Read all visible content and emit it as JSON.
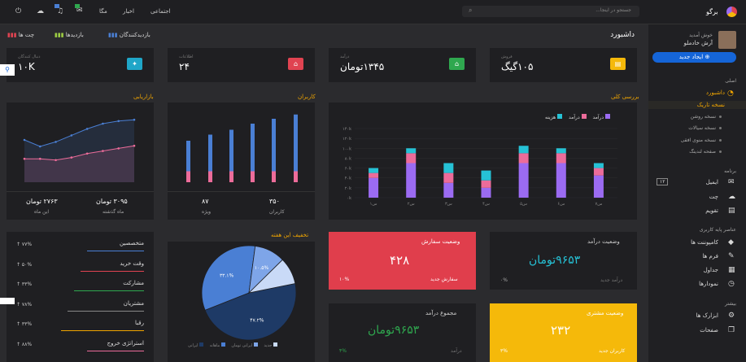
{
  "topbar": {
    "brand": "برگو",
    "search_placeholder": "جستجو در اینجا...",
    "links": [
      "اجتماعی",
      "اخبار",
      "مگا"
    ]
  },
  "sidebar": {
    "greeting": "خوش آمدید",
    "user": "آرش خادملو",
    "create_button": "ایجاد جدید",
    "sections": {
      "main": "اصلی",
      "apps": "برنامه",
      "base": "عناصر پایه کاربری",
      "more": "بیشتر"
    },
    "dashboard": "داشبورد",
    "dark_version": "نسخه تاریک",
    "subs": [
      "نسخه روشن",
      "نسخه سیالات",
      "نسخه منوی افقی",
      "صفحه لندینگ"
    ],
    "email": "ایمیل",
    "email_badge": "۱۲",
    "chat": "چت",
    "calendar": "تقویم",
    "components": "کامپوننت ها",
    "forms": "فرم ها",
    "tables": "جداول",
    "charts": "نمودارها",
    "tools": "ابزارک ها",
    "pages": "صفحات"
  },
  "header": {
    "title": "داشبورد",
    "tab_chat": "چت ها",
    "tab_visits": "بازدیدها",
    "tab_visitors": "بازدیدکنندگان"
  },
  "stats": [
    {
      "label": "فروش",
      "value": "۱۰۵گیگ",
      "color": "#f5b90a",
      "icon": "calendar-icon"
    },
    {
      "label": "درآمد",
      "value": "۱۳۴۵تومان",
      "color": "#2fa84f",
      "icon": "bank-icon"
    },
    {
      "label": "اطلاعات",
      "value": "۲۴",
      "color": "#e04351",
      "icon": "home-icon"
    },
    {
      "label": "دنبال کنندگان",
      "value": "۱۰K",
      "color": "#1fa6c8",
      "icon": "twitter-icon"
    }
  ],
  "overview": {
    "title": "بررسی کلی",
    "legend": [
      "درآمد",
      "درآمد",
      "هزینه"
    ],
    "chart_data": {
      "type": "bar",
      "stacked": true,
      "categories": [
        "س۱",
        "س۲",
        "س۳",
        "س۴",
        "س۵",
        "س۶",
        "س۷"
      ],
      "series": [
        {
          "name": "درآمد",
          "color": "#9b6bf2",
          "values": [
            40,
            70,
            30,
            20,
            70,
            70,
            45
          ]
        },
        {
          "name": "درآمد",
          "color": "#ec6c9a",
          "values": [
            10,
            20,
            20,
            15,
            20,
            20,
            15
          ]
        },
        {
          "name": "هزینه",
          "color": "#26c2d6",
          "values": [
            10,
            10,
            20,
            20,
            15,
            10,
            10
          ]
        }
      ],
      "y_ticks": [
        "۰k",
        "۲۰k",
        "۴۰k",
        "۶۰k",
        "۸۰k",
        "۱۰۰k",
        "۱۲۰k",
        "۱۴۰k"
      ],
      "ylim": [
        0,
        140
      ]
    }
  },
  "users": {
    "title": "کاربران",
    "v1": "۳۵۰",
    "l1": "کاربران",
    "v2": "۸۷",
    "l2": "ویژه",
    "chart_data": {
      "type": "bar",
      "series": [
        {
          "name": "a",
          "color": "#ec6c9a",
          "values": [
            18,
            18,
            18,
            18,
            18,
            18,
            18,
            18,
            18
          ]
        },
        {
          "name": "b",
          "color": "#4a7fd4",
          "values": [
            32,
            32,
            50,
            60,
            68,
            78,
            86,
            93,
            75
          ]
        }
      ]
    }
  },
  "market": {
    "title": "بازاریابی",
    "v1": "۳۰۹۵ تومان",
    "l1": "ماه گذشته",
    "v2": "۲۷۶۳ تومان",
    "l2": "این ماه",
    "chart_data": {
      "type": "area",
      "x": [
        0,
        1,
        2,
        3,
        4,
        5,
        6,
        7
      ],
      "series": [
        {
          "name": "a",
          "color": "#4a7fd4",
          "values": [
            65,
            55,
            62,
            72,
            82,
            90,
            94,
            96
          ]
        },
        {
          "name": "b",
          "color": "#ec6c9a",
          "values": [
            36,
            36,
            34,
            38,
            44,
            48,
            52,
            56
          ]
        }
      ]
    }
  },
  "order_status": {
    "title": "وضعیت سفارش",
    "value": "۴۲۸",
    "foot": "سفارش جدید",
    "pct": "۱۰%"
  },
  "income_status": {
    "title": "وضعیت درآمد",
    "value": "۹۶۵۳تومان",
    "foot": "درآمد جدید",
    "pct": "۰%"
  },
  "income_total": {
    "title": "مجموع درآمد",
    "value": "۹۶۵۳تومان",
    "foot": "درآمد",
    "pct": "۴%"
  },
  "customer_status": {
    "title": "وضعیت مشتری",
    "value": "۲۳۲",
    "foot": "کاربران جدید",
    "pct": "۳%"
  },
  "discount": {
    "title": "تخفیف این هفته",
    "chart_data": {
      "type": "pie",
      "slices": [
        {
          "label": "جدید",
          "value": 47.2,
          "color": "#1e3a66"
        },
        {
          "label": "ایرانی",
          "value": 33.1,
          "color": "#4a7fd4"
        },
        {
          "label": "ماهانه",
          "value": 10.5,
          "color": "#7ea5e8"
        },
        {
          "label": "",
          "value": 9.2,
          "color": "#c9daf7"
        }
      ],
      "labels_shown": [
        "۴۷.۲%",
        "۳۳.۱%",
        "۱۰.۵%"
      ],
      "legend": [
        "جدید",
        "ایرانی تومان",
        "ماهانه",
        "ایرانی"
      ]
    }
  },
  "skills": [
    {
      "label": "متخصصین",
      "pct": "۷۷%"
    },
    {
      "label": "وقت خرید",
      "pct": "۵۰%"
    },
    {
      "label": "مشارکت",
      "pct": "۳۳%"
    },
    {
      "label": "مشتریان",
      "pct": "۷۸%"
    },
    {
      "label": "رقبا",
      "pct": "۳۳%"
    },
    {
      "label": "استراتژی خروج",
      "pct": "۸۸%"
    }
  ],
  "skill_colors": [
    "#4a7fd4",
    "#e04351",
    "#2fa84f",
    "#888888",
    "#f0a500",
    "#ec6c9a"
  ]
}
